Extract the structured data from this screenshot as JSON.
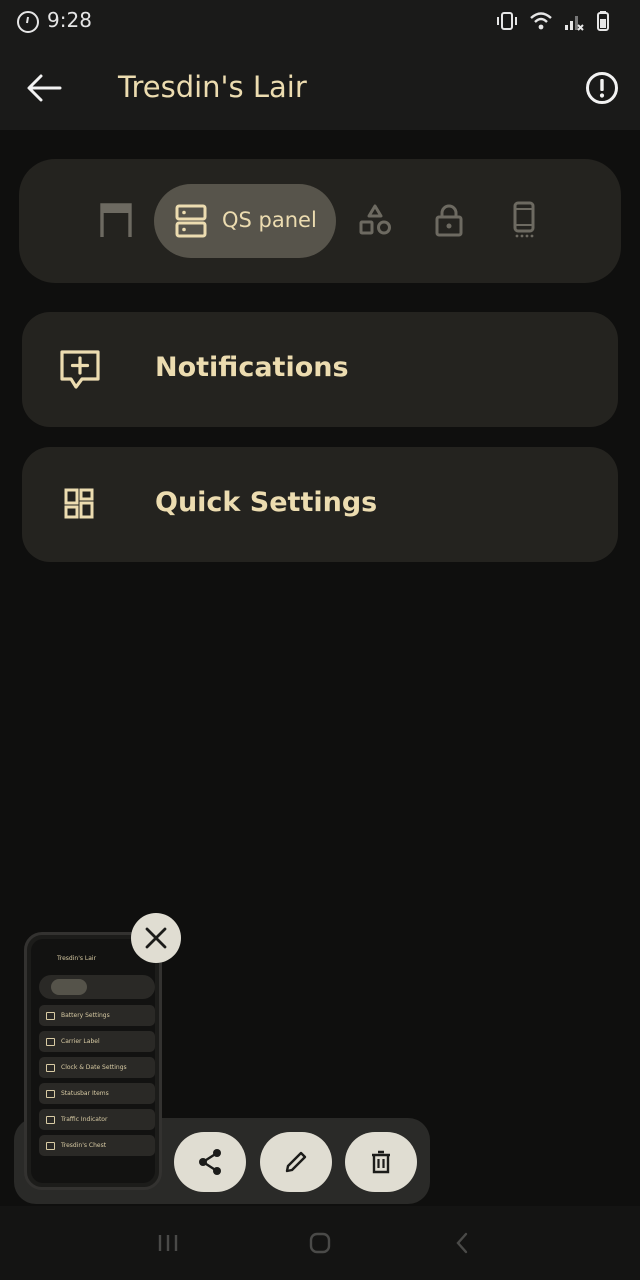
{
  "status": {
    "time": "9:28",
    "icons": [
      "clock-icon",
      "vibrate-icon",
      "wifi-icon",
      "signal-icon",
      "battery-icon"
    ]
  },
  "header": {
    "title": "Tresdin's Lair",
    "back_icon": "back-arrow-icon",
    "info_icon": "info-icon"
  },
  "tabs": {
    "items": [
      {
        "icon": "statusbar-icon"
      },
      {
        "icon": "qs-panel-icon",
        "label": "QS panel",
        "active": true
      },
      {
        "icon": "shapes-icon"
      },
      {
        "icon": "lock-icon"
      },
      {
        "icon": "phone-icon"
      }
    ]
  },
  "rows": [
    {
      "label": "Notifications",
      "icon": "notification-add-icon"
    },
    {
      "label": "Quick Settings",
      "icon": "quick-settings-icon"
    }
  ],
  "preview": {
    "title": "Tresdin's Lair",
    "items": [
      "Battery Settings",
      "Carrier Label",
      "Clock & Date Settings",
      "Statusbar Items",
      "Traffic Indicator",
      "Tresdin's Chest"
    ]
  },
  "actions": {
    "share": "share-icon",
    "edit": "edit-icon",
    "delete": "delete-icon"
  },
  "colors": {
    "accent": "#ecdcb0",
    "card": "#24231f",
    "background": "#0f0f0e",
    "active_tab": "#57544b"
  }
}
